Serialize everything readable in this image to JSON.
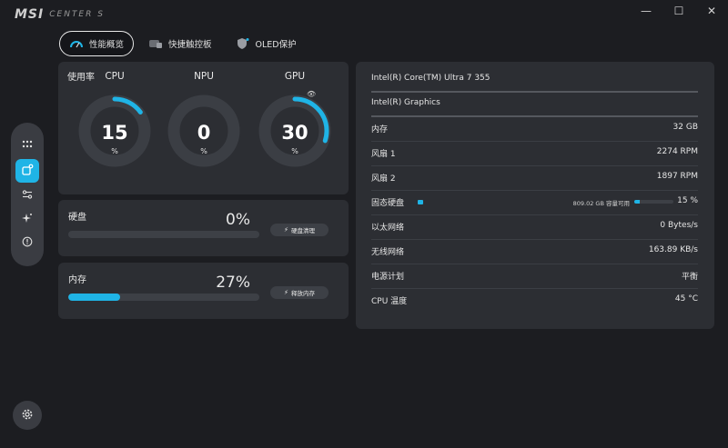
{
  "app": {
    "brand": "MSI",
    "subtitle": "CENTER S"
  },
  "window_controls": {
    "minimize": "—",
    "maximize": "☐",
    "close": "✕"
  },
  "tabs": [
    {
      "label": "性能概览",
      "icon": "speedometer-icon",
      "active": true
    },
    {
      "label": "快捷触控板",
      "icon": "touchpad-icon",
      "active": false
    },
    {
      "label": "OLED保护",
      "icon": "shield-icon",
      "active": false
    }
  ],
  "usage": {
    "title": "使用率",
    "gauges": [
      {
        "label": "CPU",
        "value": "15",
        "unit": "%",
        "percent": 15
      },
      {
        "label": "NPU",
        "value": "0",
        "unit": "%",
        "percent": 0
      },
      {
        "label": "GPU",
        "value": "30",
        "unit": "%",
        "percent": 30
      }
    ]
  },
  "disk": {
    "title": "硬盘",
    "percent_text": "0%",
    "percent": 0,
    "button": "硬盘清理"
  },
  "memory": {
    "title": "内存",
    "percent_text": "27%",
    "percent": 27,
    "button": "释放内存"
  },
  "info": {
    "cpu_name": "Intel(R) Core(TM) Ultra 7 355",
    "gpu_name": "Intel(R) Graphics",
    "rows": [
      {
        "key": "内存",
        "value": "32 GB"
      },
      {
        "key": "风扇 1",
        "value": "2274 RPM"
      },
      {
        "key": "风扇 2",
        "value": "1897 RPM"
      },
      {
        "key": "固态硬盘",
        "value": "15 %",
        "free": "809.02 GB 容量可用",
        "percent": 15
      },
      {
        "key": "以太网络",
        "value": "0 Bytes/s"
      },
      {
        "key": "无线网络",
        "value": "163.89 KB/s"
      },
      {
        "key": "电源计划",
        "value": "平衡"
      },
      {
        "key": "CPU 温度",
        "value": "45 °C"
      }
    ]
  },
  "colors": {
    "accent": "#1fb4e6",
    "panel": "#2c2e33",
    "background": "#1c1d21",
    "ring_track": "#3b3e44"
  }
}
